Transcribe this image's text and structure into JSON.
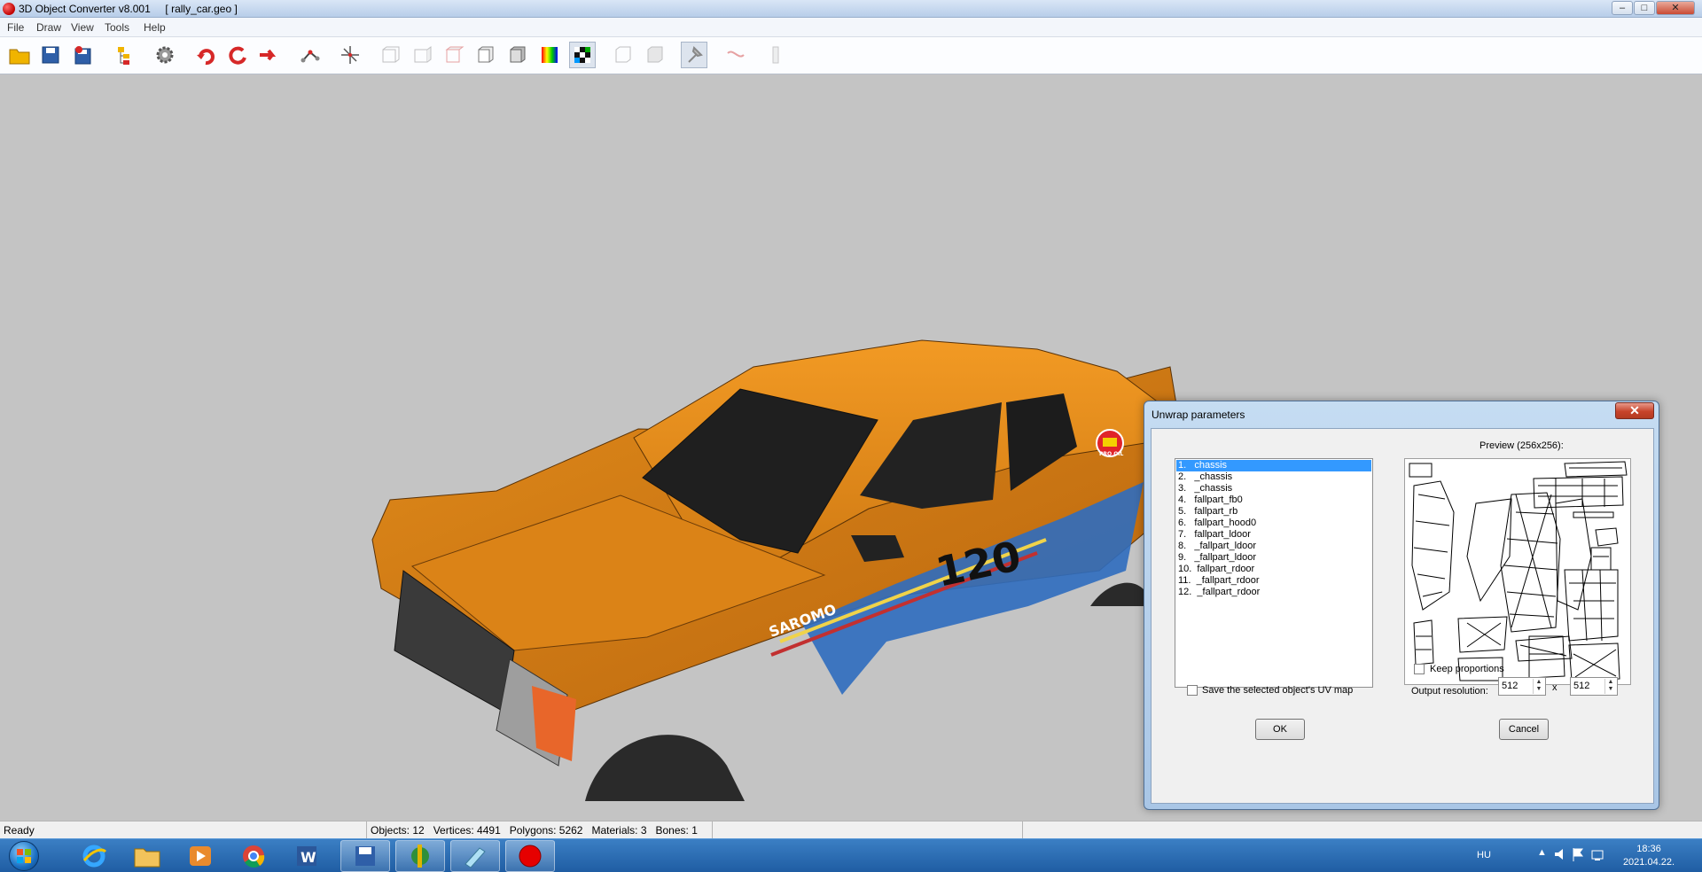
{
  "window": {
    "title": "3D Object Converter v8.001     [ rally_car.geo ]",
    "minimize_glyph": "–",
    "maximize_glyph": "□",
    "close_glyph": "✕"
  },
  "menu": [
    "File",
    "Draw",
    "View",
    "Tools",
    "Help"
  ],
  "toolbar_icons": [
    "open-folder-icon",
    "save-icon",
    "save-as-icon",
    "tree-icon",
    "settings-gear-icon",
    "rotate-left-icon",
    "rotate-icon",
    "move-icon",
    "bones-icon",
    "axis-icon",
    "view-front-icon",
    "view-side-icon",
    "view-top-icon",
    "solid-view-icon",
    "shaded-view-icon",
    "colors-view-icon",
    "texture-view-icon",
    "box-tool-icon",
    "cube-tool-icon",
    "pin-tool-icon",
    "curve-tool-icon",
    "light-tool-icon"
  ],
  "dialog": {
    "title": "Unwrap parameters",
    "close_glyph": "✕",
    "objects": [
      "1.   chassis",
      "2.   _chassis",
      "3.   _chassis",
      "4.   fallpart_fb0",
      "5.   fallpart_rb",
      "6.   fallpart_hood0",
      "7.   fallpart_ldoor",
      "8.   _fallpart_ldoor",
      "9.   _fallpart_ldoor",
      "10.  fallpart_rdoor",
      "11.  _fallpart_rdoor",
      "12.  _fallpart_rdoor"
    ],
    "selected_index": 0,
    "preview_label": "Preview (256x256):",
    "keep_proportions_label": "Keep proportions",
    "keep_proportions_checked": false,
    "save_uv_label": "Save the selected object's UV map",
    "save_uv_checked": false,
    "output_resolution_label": "Output resolution:",
    "res_width": "512",
    "res_height": "512",
    "times": "x",
    "ok_label": "OK",
    "cancel_label": "Cancel"
  },
  "car_decals": {
    "race_number": "120",
    "sponsor": "SAROMO",
    "badge": "PRO OIL"
  },
  "status": {
    "ready": "Ready",
    "stats": "Objects: 12   Vertices: 4491   Polygons: 5262   Materials: 3   Bones: 1"
  },
  "taskbar": {
    "apps": [
      "internet-explorer-icon",
      "file-explorer-icon",
      "media-player-icon",
      "chrome-icon",
      "word-icon",
      "save-app-icon",
      "paint-app-icon",
      "pen-app-icon",
      "converter-app-icon"
    ],
    "lang": "HU",
    "time": "18:36",
    "date": "2021.04.22."
  },
  "colors": {
    "viewport_bg": "#c4c4c4",
    "car_orange": "#d27c14",
    "selection_blue": "#3399ff"
  }
}
